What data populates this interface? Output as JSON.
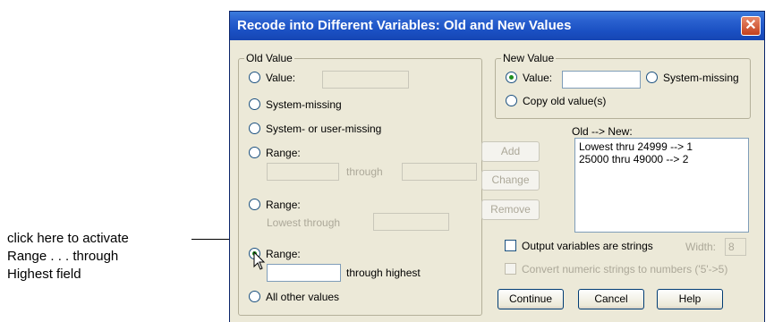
{
  "annotation": {
    "lines": [
      "click here to activate",
      "Range . . . through",
      "Highest field"
    ]
  },
  "window": {
    "title": "Recode into Different Variables: Old and New Values",
    "close_glyph": "✕"
  },
  "old_value": {
    "legend": "Old Value",
    "value_label": "Value:",
    "system_missing_label": "System-missing",
    "system_or_user_missing_label": "System- or user-missing",
    "range1_label": "Range:",
    "range1_through": "through",
    "range2_label": "Range:",
    "range2_lowest_through": "Lowest through",
    "range3_label": "Range:",
    "range3_through_highest": "through highest",
    "all_other_label": "All other values",
    "value_input": "",
    "range1_from": "",
    "range1_to": "",
    "range2_to": "",
    "range3_from": "",
    "selected": "range3"
  },
  "new_value": {
    "legend": "New Value",
    "value_label": "Value:",
    "system_missing_label": "System-missing",
    "copy_old_label": "Copy old value(s)",
    "value_input": "",
    "selected": "value"
  },
  "mapping": {
    "header": "Old --> New:",
    "add_label": "Add",
    "change_label": "Change",
    "remove_label": "Remove",
    "items": [
      "Lowest thru 24999 --> 1",
      "25000 thru 49000 --> 2"
    ]
  },
  "options": {
    "output_strings_label": "Output variables are strings",
    "width_label": "Width:",
    "width_value": "8",
    "convert_label": "Convert numeric strings to numbers ('5'->5)"
  },
  "buttons": {
    "continue_label": "Continue",
    "cancel_label": "Cancel",
    "help_label": "Help"
  },
  "colors": {
    "titlebar": "#2a62d0",
    "dialog_bg": "#ece9d8",
    "radio_dot": "#1e8f1e",
    "close_button": "#c4401c"
  }
}
